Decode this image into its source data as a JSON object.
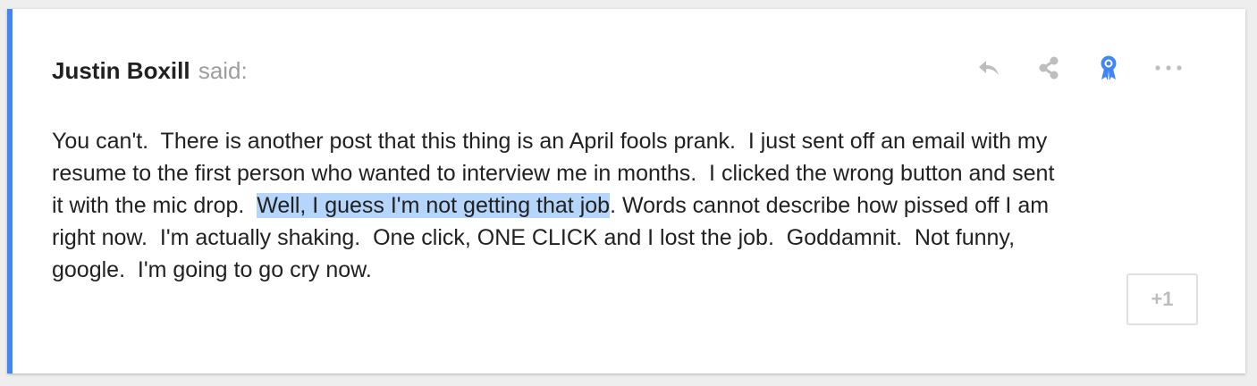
{
  "post": {
    "author": "Justin Boxill",
    "said_label": "said:",
    "body_before": "You can't.  There is another post that this thing is an April fools prank.  I just sent off an email with my\nresume to the first person who wanted to interview me in months.  I clicked the wrong button and sent\nit with the mic drop.  ",
    "body_highlighted": "Well, I guess I'm not getting that job",
    "body_after": ". Words cannot describe how pissed off I am\nright now.  I'm actually shaking.  One click, ONE CLICK and I lost the job.  Goddamnit.  Not funny,\ngoogle.  I'm going to go cry now.",
    "plus_one_label": "+1"
  },
  "actions": [
    {
      "icon": "reply-icon"
    },
    {
      "icon": "share-icon"
    },
    {
      "icon": "award-ribbon-icon"
    },
    {
      "icon": "more-icon"
    }
  ],
  "colors": {
    "accent": "#4285f4",
    "highlight": "#b5d5fb",
    "icon_gray": "#bdbdbd",
    "icon_blue": "#4285f4"
  }
}
